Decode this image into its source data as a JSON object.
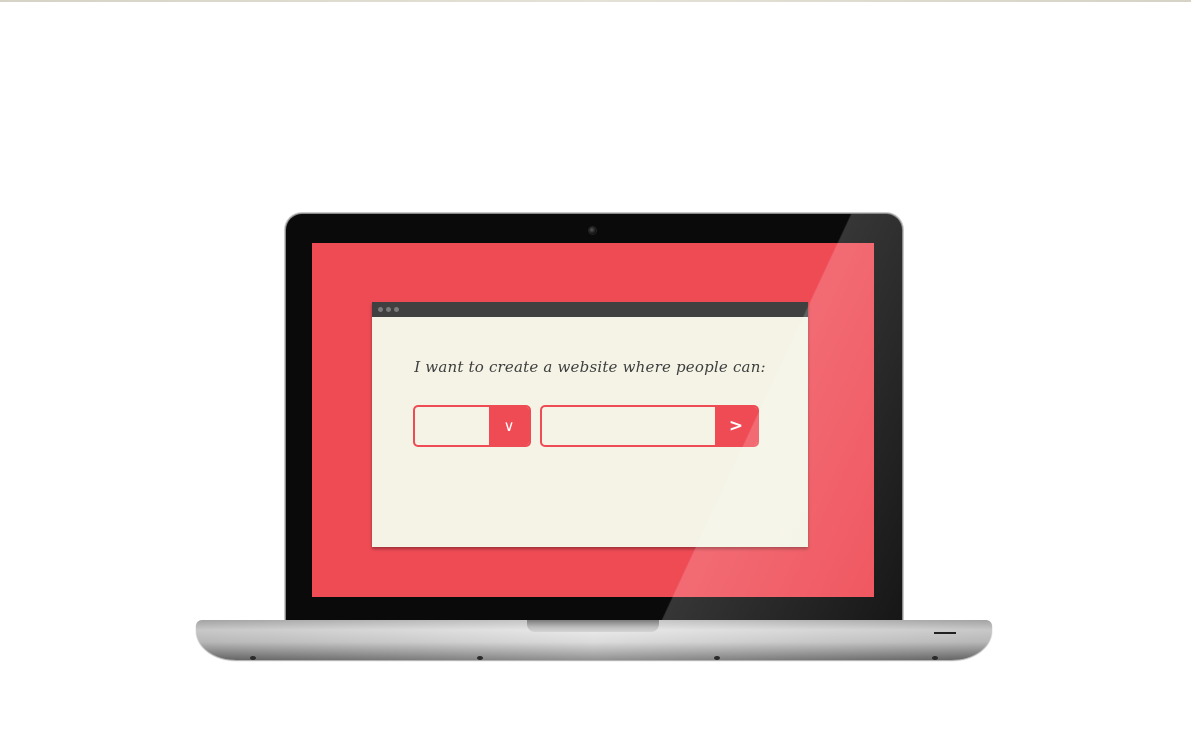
{
  "screen": {
    "background_color": "#ef4b55",
    "browser": {
      "background_color": "#f4f3e6",
      "title_bar_color": "#404040",
      "prompt": "I want to create a website where people can:",
      "select": {
        "value": "",
        "icon": "chevron-down-icon",
        "icon_glyph": "∨"
      },
      "text_input": {
        "value": "",
        "placeholder": ""
      },
      "submit": {
        "icon": "chevron-right-icon",
        "icon_glyph": ">"
      }
    }
  }
}
